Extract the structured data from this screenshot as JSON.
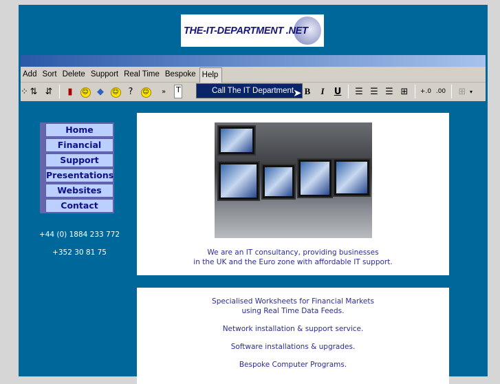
{
  "logo": {
    "text": "THE-IT-DEPARTMENT .NET"
  },
  "menu": [
    "Add",
    "Sort",
    "Delete",
    "Support",
    "Real Time",
    "Bespoke",
    "Help"
  ],
  "dropdown": {
    "item": "Call The IT Department"
  },
  "toolbar": {
    "font_box": "T",
    "bold": "B",
    "italic": "I",
    "underline": "U",
    "more": "»"
  },
  "nav": [
    "Home",
    "Financial",
    "Support",
    "Presentations",
    "Websites",
    "Contact"
  ],
  "phones": [
    "+44 (0) 1884 233 772",
    "+352 30 81 75"
  ],
  "intro": [
    "We are an IT consultancy,  providing businesses",
    "in the UK and the Euro zone with affordable IT support."
  ],
  "services": [
    "Specialised Worksheets for Financial Markets",
    "using Real Time Data Feeds.",
    "Network installation & support service.",
    "Software installations & upgrades.",
    "Bespoke Computer Programs."
  ],
  "colors": {
    "panel": "#00679b",
    "nav_bg": "#bcd0ff",
    "nav_text": "#10108a",
    "menu_highlight": "#0a246a"
  }
}
